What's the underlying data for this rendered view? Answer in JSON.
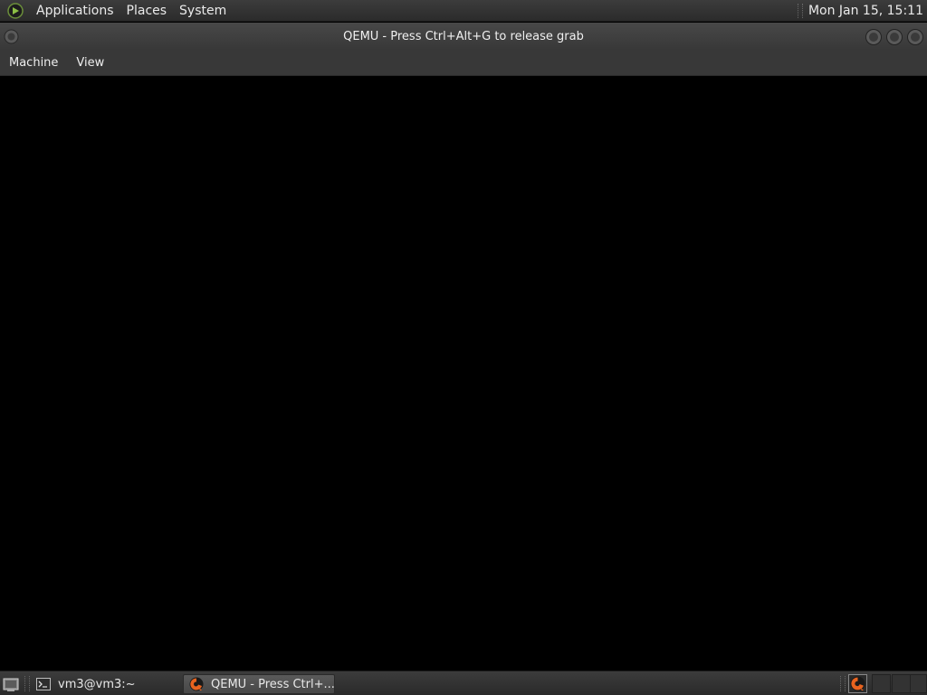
{
  "top_panel": {
    "menus": [
      "Applications",
      "Places",
      "System"
    ],
    "clock": "Mon Jan 15, 15:11",
    "logo_icon": "distro-logo-icon"
  },
  "window": {
    "title": "QEMU - Press Ctrl+Alt+G to release grab",
    "menu": [
      "Machine",
      "View"
    ],
    "screen_color": "#000000"
  },
  "taskbar": {
    "tasks": [
      {
        "label": "vm3@vm3:~",
        "icon": "terminal-icon",
        "active": false
      },
      {
        "label": "QEMU - Press Ctrl+...",
        "icon": "qemu-icon",
        "active": true
      }
    ],
    "tray_icon": "qemu-icon"
  },
  "colors": {
    "panel": "#333333",
    "titlebar": "#404040",
    "text": "#e6e6e6",
    "qemu_orange": "#e8631f"
  }
}
